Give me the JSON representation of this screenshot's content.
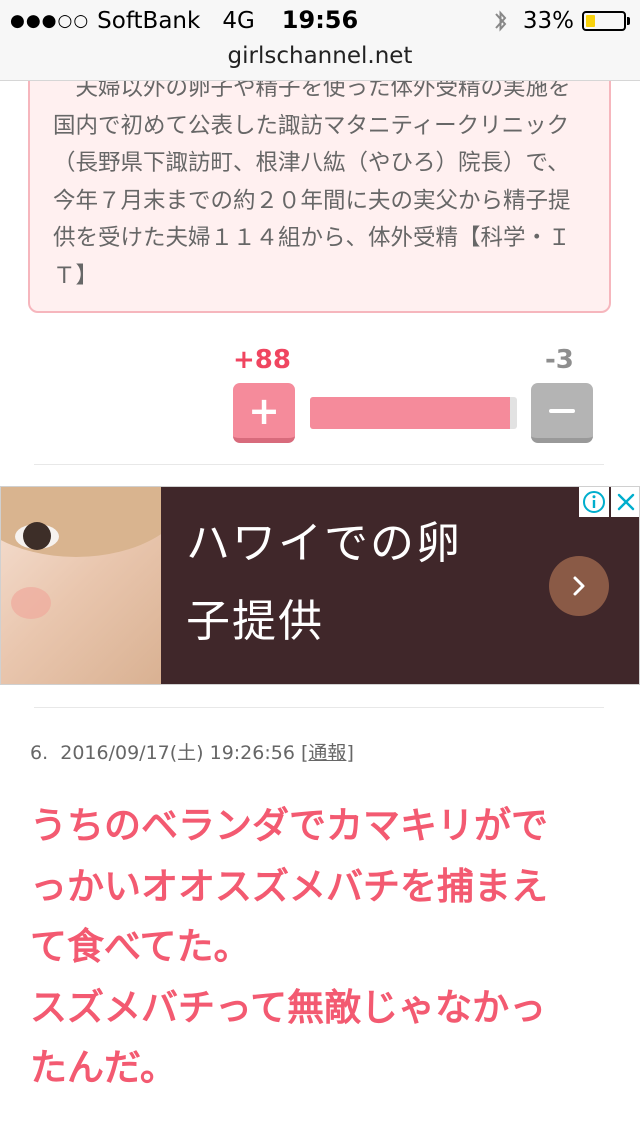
{
  "status_bar": {
    "signal": "●●●○○",
    "carrier": "SoftBank",
    "network": "4G",
    "time": "19:56",
    "battery_percent": "33%",
    "battery_level": 0.33,
    "url": "girlschannel.net"
  },
  "quote": {
    "text": "　夫婦以外の卵子や精子を使った体外受精の実施を国内で初めて公表した諏訪マタニティークリニック（長野県下諏訪町、根津八紘（やひろ）院長）で、今年７月末までの約２０年間に夫の実父から精子提供を受けた夫婦１１４組から、体外受精【科学・ＩＴ】"
  },
  "votes": {
    "plus": "+88",
    "minus": "-3",
    "plus_label": "+",
    "ratio": 0.967
  },
  "ad": {
    "line1": "ハワイでの卵",
    "line2": "子提供"
  },
  "comment": {
    "number": "6.",
    "datetime": "2016/09/17(土) 19:26:56",
    "report_open": "[",
    "report_label": "通報",
    "report_close": "]",
    "line1": "うちのベランダでカマキリがで",
    "line2": "っかいオオスズメバチを捕まえ",
    "line3": "て食べてた。",
    "line4": "スズメバチって無敵じゃなかっ",
    "line5": "たんだ。"
  },
  "colors": {
    "accent_pink": "#f58b9b",
    "comment_text": "#f35a71",
    "plus_count": "#f04560"
  }
}
